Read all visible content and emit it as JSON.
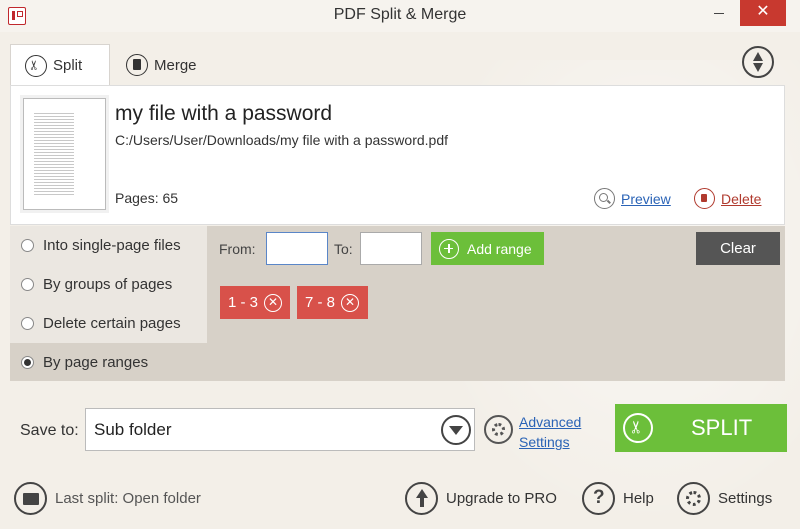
{
  "window": {
    "title": "PDF Split & Merge",
    "minimize": "",
    "close": "✕"
  },
  "tabs": [
    {
      "label": "Split",
      "icon": "scissors-icon",
      "active": true
    },
    {
      "label": "Merge",
      "icon": "document-icon",
      "active": false
    }
  ],
  "file": {
    "name": "my file with a password",
    "path": "C:/Users/User/Downloads/my file with a password.pdf",
    "pages_text": "Pages: 65",
    "preview_label": "Preview",
    "delete_label": "Delete"
  },
  "split_modes": [
    {
      "label": "Into single-page files",
      "selected": false
    },
    {
      "label": "By groups of pages",
      "selected": false
    },
    {
      "label": "Delete certain pages",
      "selected": false
    },
    {
      "label": "By page ranges",
      "selected": true
    }
  ],
  "range": {
    "from_label": "From:",
    "from_value": "",
    "to_label": "To:",
    "to_value": "",
    "add_label": "Add range",
    "clear_label": "Clear",
    "chips": [
      "1 - 3",
      "7 - 8"
    ]
  },
  "save": {
    "label": "Save to:",
    "value": "Sub folder",
    "advanced_line1": "Advanced",
    "advanced_line2": "Settings",
    "split_label": "SPLIT"
  },
  "footer": {
    "last_split": "Last split: Open folder",
    "upgrade": "Upgrade to PRO",
    "help": "Help",
    "settings": "Settings"
  },
  "colors": {
    "accent_green": "#6cbf3a",
    "chip_red": "#d8514a",
    "clear_gray": "#555555",
    "link_blue": "#2a63b6"
  }
}
